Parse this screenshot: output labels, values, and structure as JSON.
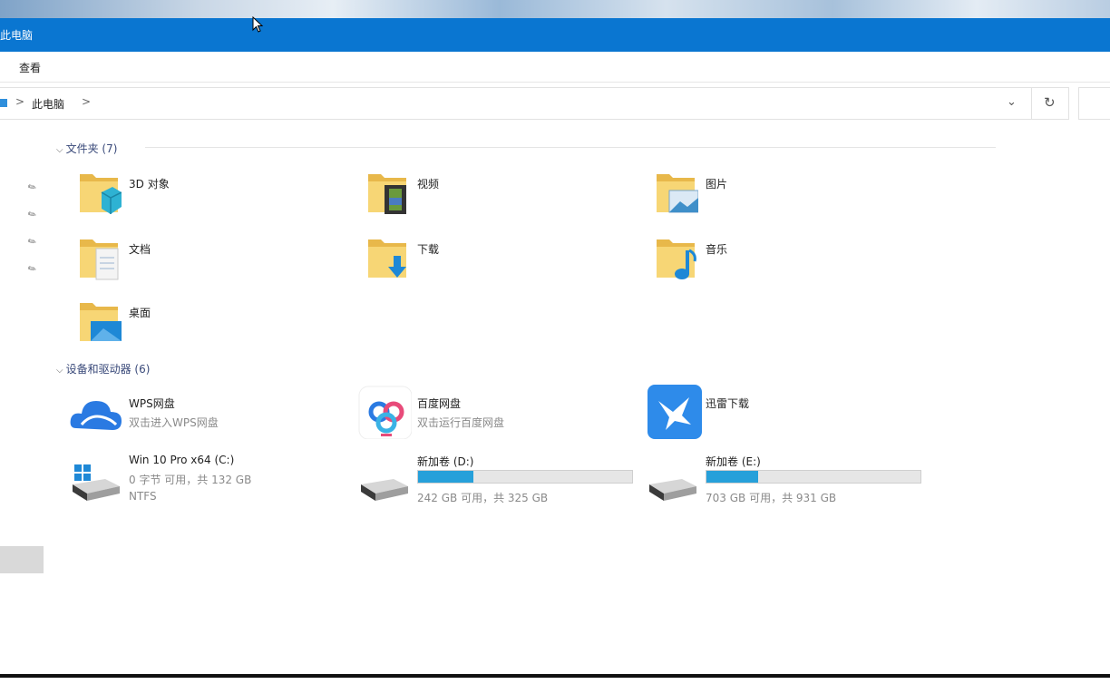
{
  "window": {
    "title": "此电脑"
  },
  "ribbon": {
    "tab_view": "查看"
  },
  "address": {
    "crumb": "此电脑",
    "separator": ">"
  },
  "folders_group": {
    "header": "文件夹 (7)",
    "items": [
      {
        "label": "3D 对象",
        "icon": "3d-objects-folder-icon"
      },
      {
        "label": "视频",
        "icon": "videos-folder-icon"
      },
      {
        "label": "图片",
        "icon": "pictures-folder-icon"
      },
      {
        "label": "文档",
        "icon": "documents-folder-icon"
      },
      {
        "label": "下载",
        "icon": "downloads-folder-icon"
      },
      {
        "label": "音乐",
        "icon": "music-folder-icon"
      },
      {
        "label": "桌面",
        "icon": "desktop-folder-icon"
      }
    ]
  },
  "devices_group": {
    "header": "设备和驱动器 (6)",
    "items": [
      {
        "label": "WPS网盘",
        "sub": "双击进入WPS网盘",
        "icon": "wps-cloud-icon"
      },
      {
        "label": "百度网盘",
        "sub": "双击运行百度网盘",
        "icon": "baidu-netdisk-icon"
      },
      {
        "label": "迅雷下载",
        "icon": "xunlei-icon"
      },
      {
        "label": "Win 10 Pro x64 (C:)",
        "sub": "0 字节 可用，共 132 GB",
        "sub2": "NTFS",
        "icon": "windows-drive-icon"
      },
      {
        "label": "新加卷 (D:)",
        "sub": "242 GB 可用，共 325 GB",
        "used_fraction": 0.26,
        "icon": "hard-drive-icon"
      },
      {
        "label": "新加卷 (E:)",
        "sub": "703 GB 可用，共 931 GB",
        "used_fraction": 0.24,
        "icon": "hard-drive-icon"
      }
    ]
  },
  "colors": {
    "titlebar": "#0a76d1",
    "bar_fill": "#26a0da"
  }
}
